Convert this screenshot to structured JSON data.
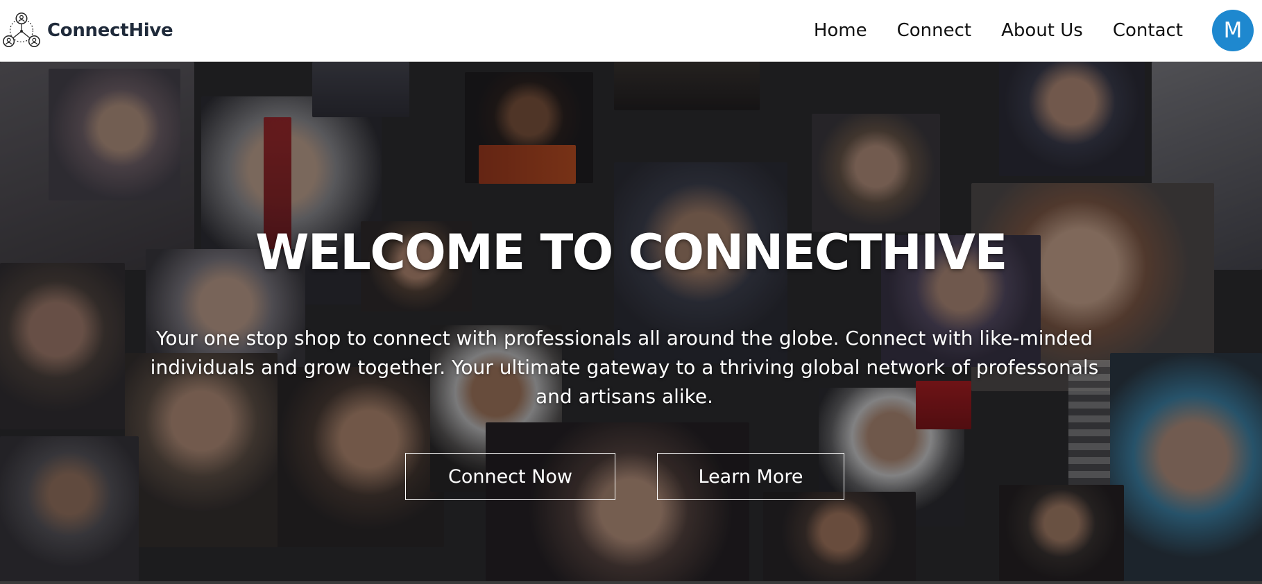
{
  "brand": {
    "name": "ConnectHive",
    "logo_icon": "network-people-icon"
  },
  "nav": {
    "links": [
      "Home",
      "Connect",
      "About Us",
      "Contact"
    ],
    "avatar_initial": "M",
    "avatar_color": "#1e88cf"
  },
  "hero": {
    "title": "WELCOME TO CONNECTHIVE",
    "subtitle": "Your one stop shop to connect with professionals all around the globe. Connect with like-minded individuals and grow together. Your ultimate gateway to a thriving global network of professonals and artisans alike.",
    "background": "collage-of-smiling-people-photo",
    "buttons": {
      "primary": "Connect Now",
      "secondary": "Learn More"
    }
  }
}
